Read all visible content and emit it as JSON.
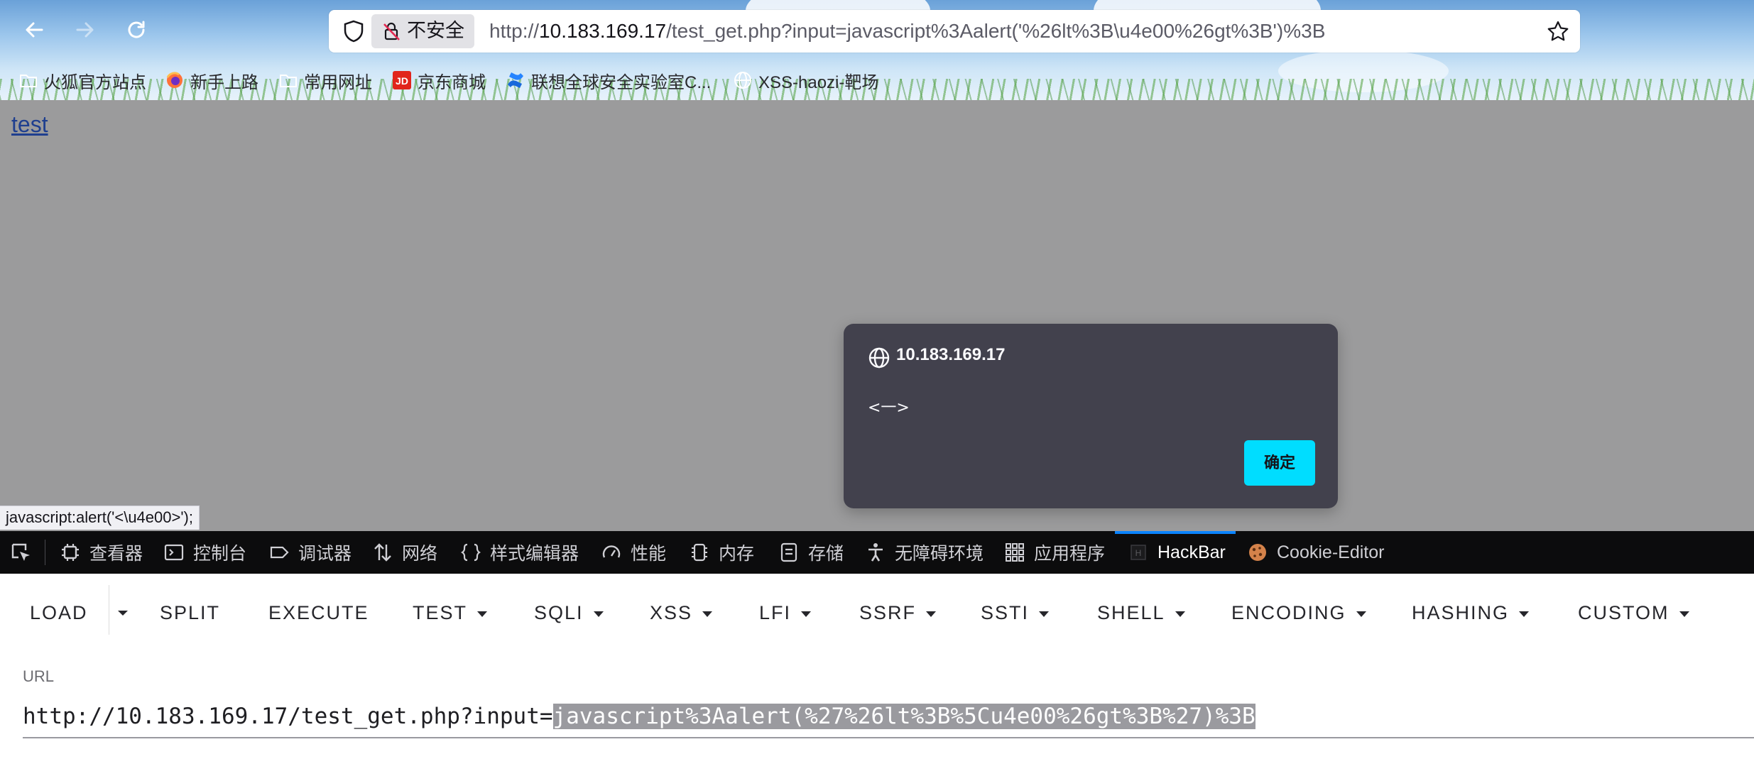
{
  "browser": {
    "security_label": "不安全",
    "url_prefix": "http://",
    "url_host": "10.183.169.17",
    "url_rest": "/test_get.php?input=javascript%3Aalert('%26lt%3B\\u4e00%26gt%3B')%3B",
    "bookmarks": [
      {
        "label": "火狐官方站点",
        "icon": "folder-icon"
      },
      {
        "label": "新手上路",
        "icon": "firefox-icon"
      },
      {
        "label": "常用网址",
        "icon": "folder-icon"
      },
      {
        "label": "京东商城",
        "icon": "jd-icon"
      },
      {
        "label": "联想全球安全实验室C...",
        "icon": "confluence-icon"
      },
      {
        "label": "XSS-haozi-靶场",
        "icon": "globe-icon"
      }
    ]
  },
  "page": {
    "link_text": "test",
    "status_text": "javascript:alert('<\\u4e00>');"
  },
  "alert": {
    "origin": "10.183.169.17",
    "message": "<一>",
    "ok_label": "确定",
    "ok_color": "#00ddff"
  },
  "devtools": {
    "tabs": [
      {
        "label": "查看器",
        "icon": "inspector-icon"
      },
      {
        "label": "控制台",
        "icon": "console-icon"
      },
      {
        "label": "调试器",
        "icon": "debugger-icon"
      },
      {
        "label": "网络",
        "icon": "network-icon"
      },
      {
        "label": "样式编辑器",
        "icon": "style-editor-icon"
      },
      {
        "label": "性能",
        "icon": "performance-icon"
      },
      {
        "label": "内存",
        "icon": "memory-icon"
      },
      {
        "label": "存储",
        "icon": "storage-icon"
      },
      {
        "label": "无障碍环境",
        "icon": "accessibility-icon"
      },
      {
        "label": "应用程序",
        "icon": "application-icon"
      },
      {
        "label": "HackBar",
        "icon": "hackbar-icon",
        "active": true
      },
      {
        "label": "Cookie-Editor",
        "icon": "cookie-icon"
      }
    ],
    "accent": "#0a84ff"
  },
  "hackbar": {
    "menu": [
      "LOAD",
      "SPLIT",
      "EXECUTE",
      "TEST",
      "SQLI",
      "XSS",
      "LFI",
      "SSRF",
      "SSTI",
      "SHELL",
      "ENCODING",
      "HASHING",
      "CUSTOM"
    ],
    "url_label": "URL",
    "url_plain": "http://10.183.169.17/test_get.php?input=",
    "url_selected": "javascript%3Aalert(%27%26lt%3B%5Cu4e00%26gt%3B%27)%3B"
  }
}
